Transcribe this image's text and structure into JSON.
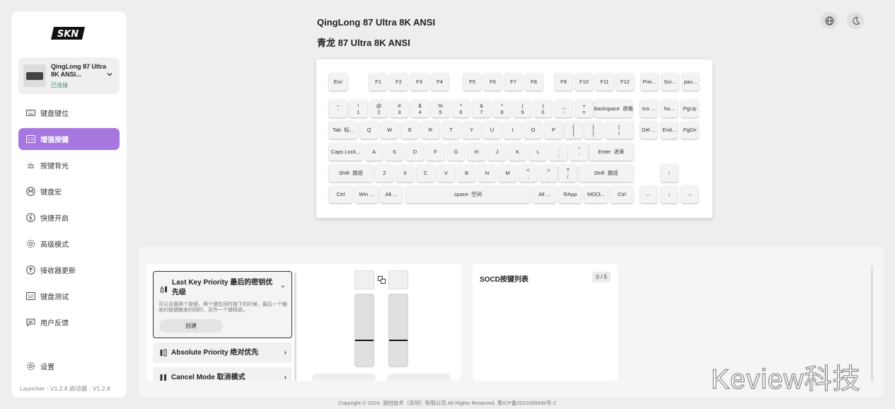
{
  "app": {
    "logo_text": "SKN",
    "version": "Launcher - V1.2.8   启动器 - V1.2.8"
  },
  "device": {
    "name": "QingLong 87 Ultra 8K ANSI...",
    "status": "已连接",
    "icon": "keyboard-icon"
  },
  "nav": [
    {
      "label": "键盘键位",
      "icon": "keyboard-layout-icon",
      "active": false
    },
    {
      "label": "增强按键",
      "icon": "enhanced-key-icon",
      "active": true
    },
    {
      "label": "按键背光",
      "icon": "backlight-icon",
      "active": false
    },
    {
      "label": "键盘宏",
      "icon": "macro-icon",
      "active": false
    },
    {
      "label": "快捷开启",
      "icon": "quick-start-icon",
      "active": false
    },
    {
      "label": "高级模式",
      "icon": "advanced-icon",
      "active": false
    },
    {
      "label": "接收器更新",
      "icon": "update-icon",
      "active": false
    },
    {
      "label": "键盘测试",
      "icon": "test-icon",
      "active": false
    },
    {
      "label": "用户反馈",
      "icon": "feedback-icon",
      "active": false
    },
    {
      "label": "设置",
      "icon": "settings-icon",
      "active": false
    }
  ],
  "header": {
    "title_en": "QingLong 87 Ultra 8K ANSI",
    "title_cn": "青龙 87 Ultra 8K ANSI"
  },
  "top_buttons": [
    {
      "icon": "globe-icon"
    },
    {
      "icon": "moon-icon"
    }
  ],
  "keys": [
    {
      "label": "Esc"
    },
    {
      "label": "F1"
    },
    {
      "label": "F2"
    },
    {
      "label": "F3"
    },
    {
      "label": "F4"
    },
    {
      "label": "F5"
    },
    {
      "label": "F6"
    },
    {
      "label": "F7"
    },
    {
      "label": "F8"
    },
    {
      "label": "F9"
    },
    {
      "label": "F10"
    },
    {
      "label": "F11"
    },
    {
      "label": "F12"
    },
    {
      "label": "Prin..."
    },
    {
      "label": "Scr..."
    },
    {
      "label": "pau..."
    },
    {
      "label": "~\n`"
    },
    {
      "label": "!\n1"
    },
    {
      "label": "@\n2"
    },
    {
      "label": "#\n3"
    },
    {
      "label": "$\n4"
    },
    {
      "label": "%\n5"
    },
    {
      "label": "^\n6"
    },
    {
      "label": "&\n7"
    },
    {
      "label": "*\n8"
    },
    {
      "label": "(\n9"
    },
    {
      "label": ")\n0"
    },
    {
      "label": "_\n-"
    },
    {
      "label": "+\n="
    },
    {
      "label": "Backspace  退格"
    },
    {
      "label": "Ins ..."
    },
    {
      "label": "ho..."
    },
    {
      "label": "PgUp"
    },
    {
      "label": "Tab  标..."
    },
    {
      "label": "Q"
    },
    {
      "label": "W"
    },
    {
      "label": "E"
    },
    {
      "label": "R"
    },
    {
      "label": "T"
    },
    {
      "label": "Y"
    },
    {
      "label": "U"
    },
    {
      "label": "I"
    },
    {
      "label": "O"
    },
    {
      "label": "P"
    },
    {
      "label": "{\n["
    },
    {
      "label": "}\n]"
    },
    {
      "label": "|\n\\"
    },
    {
      "label": "Del ..."
    },
    {
      "label": "End..."
    },
    {
      "label": "PgDn"
    },
    {
      "label": "Caps Lock..."
    },
    {
      "label": "A"
    },
    {
      "label": "S"
    },
    {
      "label": "D"
    },
    {
      "label": "F"
    },
    {
      "label": "G"
    },
    {
      "label": "H"
    },
    {
      "label": "J"
    },
    {
      "label": "K"
    },
    {
      "label": "L"
    },
    {
      "label": ":\n;"
    },
    {
      "label": "\"\n'"
    },
    {
      "label": "Enter  进来"
    },
    {
      "label": "Shift  换班"
    },
    {
      "label": "Z"
    },
    {
      "label": "X"
    },
    {
      "label": "C"
    },
    {
      "label": "V"
    },
    {
      "label": "B"
    },
    {
      "label": "N"
    },
    {
      "label": "M"
    },
    {
      "label": "<\n,"
    },
    {
      "label": ">\n."
    },
    {
      "label": "?\n/"
    },
    {
      "label": "Shift  换班"
    },
    {
      "label": "↑"
    },
    {
      "label": "Ctrl"
    },
    {
      "label": "Win ..."
    },
    {
      "label": "Alt ..."
    },
    {
      "label": "space  空间"
    },
    {
      "label": "Alt ..."
    },
    {
      "label": "RApp"
    },
    {
      "label": "MO(3..."
    },
    {
      "label": "Ctrl"
    },
    {
      "label": "←"
    },
    {
      "label": "↓"
    },
    {
      "label": "→"
    }
  ],
  "modes": [
    {
      "title": "Last Key Priority  最后的密钥优先级",
      "desc": "可以设置两个按键，两个键在同时按下的时候，最后一个触发的按键触发的同时，另外一个键释放。",
      "button": "创建",
      "selected": true,
      "icon": "last-key-icon"
    },
    {
      "title": "Absolute Priority  绝对优先",
      "selected": false,
      "icon": "absolute-priority-icon"
    },
    {
      "title": "Cancel Mode  取消模式",
      "selected": false,
      "icon": "cancel-mode-icon"
    }
  ],
  "socd": {
    "title": "SOCD按键列表",
    "count": "0 / 5"
  },
  "watermark": "Keview科技",
  "footer": "Copyright © 2024. 湖创技术（深圳）有限公司 All Rights Reserved. 粤ICP备2021099938号-2"
}
